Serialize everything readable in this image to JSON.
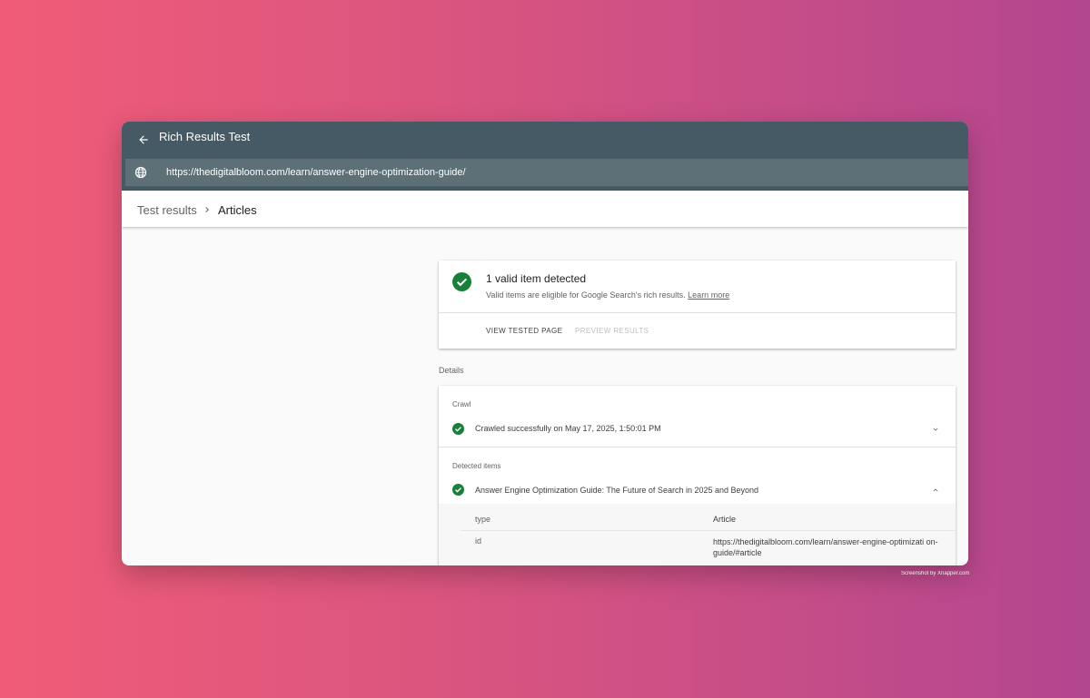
{
  "app": {
    "title": "Rich Results Test",
    "url": "https://thedigitalbloom.com/learn/answer-engine-optimization-guide/"
  },
  "breadcrumb": {
    "root": "Test results",
    "current": "Articles"
  },
  "summary": {
    "title": "1 valid item detected",
    "subtitle": "Valid items are eligible for Google Search's rich results.",
    "learn_more": "Learn more",
    "view_tested_page": "VIEW TESTED PAGE",
    "preview_results": "PREVIEW RESULTS"
  },
  "details": {
    "label": "Details",
    "crawl": {
      "label": "Crawl",
      "status": "Crawled successfully on May 17, 2025, 1:50:01 PM"
    },
    "detected": {
      "label": "Detected items",
      "item": "Answer Engine Optimization Guide: The Future of Search in 2025 and Beyond",
      "properties": [
        {
          "key": "type",
          "value": "Article"
        },
        {
          "key": "id",
          "value": "https://thedigitalbloom.com/learn/answer-engine-optimizati on-guide/#article"
        }
      ]
    }
  },
  "watermark": "Screenshot by Xnapper.com",
  "colors": {
    "topbar": "#455a64",
    "urlbar": "#5d7078",
    "success": "#188038"
  },
  "icons": [
    "back-arrow-icon",
    "globe-icon",
    "chevron-right-icon",
    "check-circle-icon",
    "chevron-down-icon",
    "chevron-up-icon"
  ]
}
